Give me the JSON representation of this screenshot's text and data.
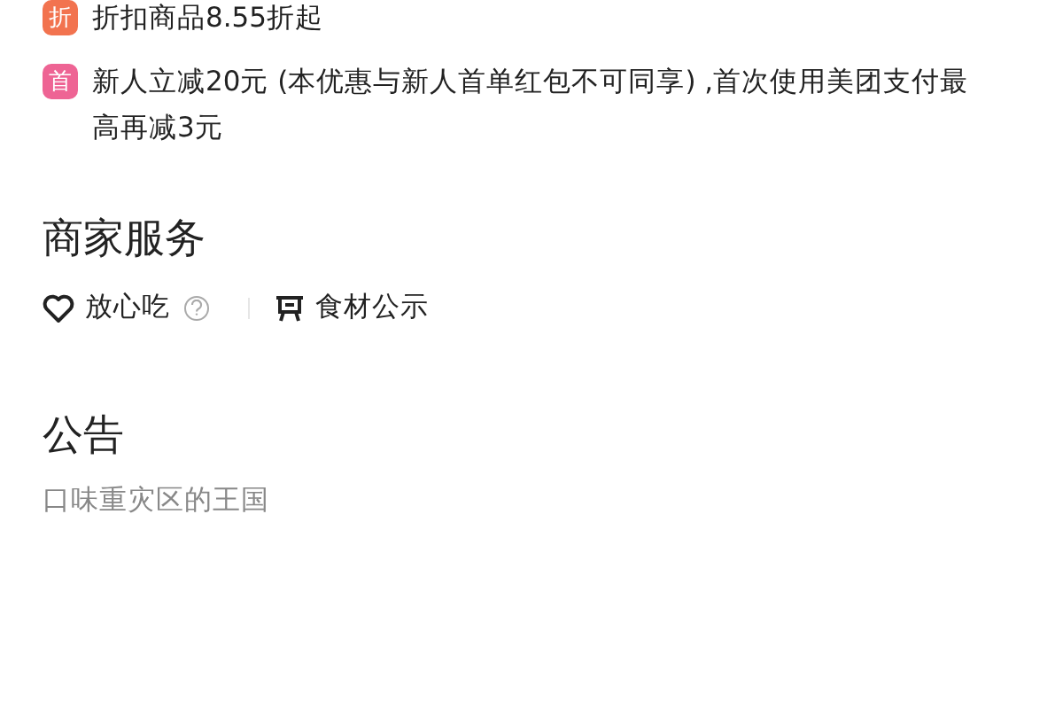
{
  "promotions": [
    {
      "badge": "折",
      "color": "#f2734f",
      "text": "折扣商品8.55折起"
    },
    {
      "badge": "首",
      "color": "#ee6494",
      "text": "新人立减20元 (本优惠与新人首单红包不可同享) ,首次使用美团支付最高再减3元"
    }
  ],
  "merchant_services": {
    "title": "商家服务",
    "items": [
      {
        "kind": "heart",
        "label": "放心吃",
        "help": true
      },
      {
        "kind": "tray",
        "label": "食材公示",
        "help": false
      }
    ]
  },
  "announcement": {
    "title": "公告",
    "text": "口味重灾区的王国"
  }
}
